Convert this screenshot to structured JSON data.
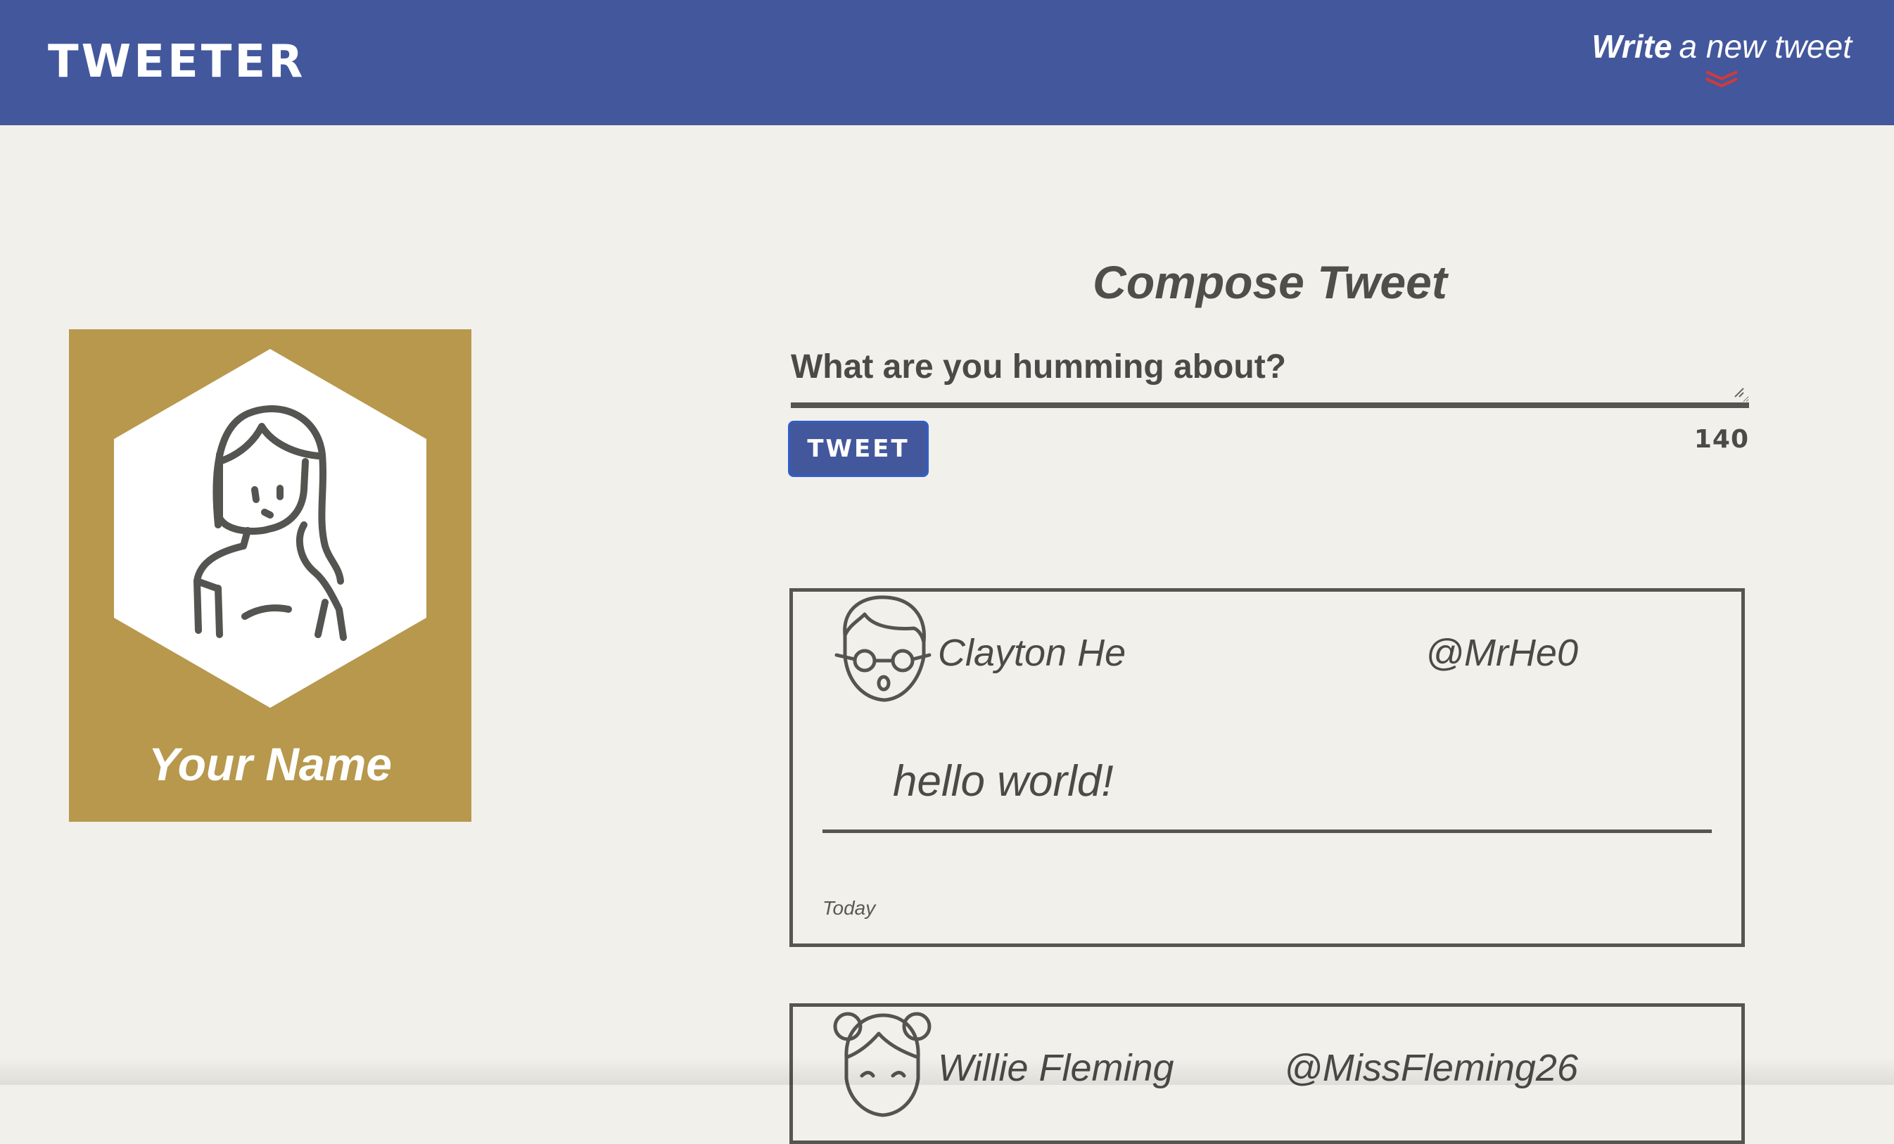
{
  "header": {
    "brand": "TWEETER",
    "write_strong": "Write",
    "write_rest": "a new tweet",
    "chevron_icon": "double-chevron-down-icon",
    "background_color": "#43579c",
    "chevron_color": "#d23a3a"
  },
  "profile": {
    "name": "Your Name",
    "avatar_icon": "woman-avatar-icon",
    "background_color": "#b7984d"
  },
  "compose": {
    "title": "Compose Tweet",
    "placeholder": "What are you humming about?",
    "button_label": "TWEET",
    "counter": "140"
  },
  "tweets": [
    {
      "author": "Clayton He",
      "handle": "@MrHe0",
      "content": "hello world!",
      "date": "Today",
      "avatar_icon": "boy-with-glasses-avatar-icon"
    },
    {
      "author": "Willie Fleming",
      "handle": "@MissFleming26",
      "avatar_icon": "girl-with-buns-avatar-icon"
    }
  ]
}
